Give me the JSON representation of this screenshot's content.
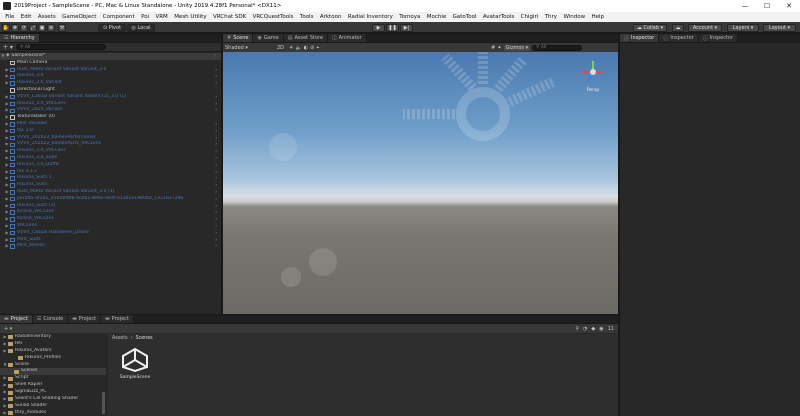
{
  "window": {
    "title": "2019Project - SampleScene - PC, Mac & Linux Standalone - Unity 2019.4.28f1 Personal* <DX11>",
    "minimize": "—",
    "maximize": "☐",
    "close": "✕"
  },
  "menu": [
    "File",
    "Edit",
    "Assets",
    "GameObject",
    "Component",
    "Poi",
    "VRM",
    "Mesh Utility",
    "VRChat SDK",
    "VRCQuestTools",
    "Tools",
    "Arktoon",
    "Radial Inventory",
    "Tomoya",
    "Mochie",
    "GatoTool",
    "AvatarTools",
    "Chigiri",
    "Thry",
    "Window",
    "Help"
  ],
  "toolbar": {
    "pivot": "Pivot",
    "local": "Local",
    "play": "▶",
    "pause": "❚❚",
    "step": "▶|",
    "collab": "Collab ▾",
    "account": "Account ▾",
    "layers": "Layers ▾",
    "layout": "Layout ▾"
  },
  "hierarchy": {
    "tab": "Hierarchy",
    "add": "+ ▾",
    "search_placeholder": "All",
    "scene": "SampleScene*",
    "items": [
      {
        "label": "Main Camera",
        "prefab": false,
        "arrow": ""
      },
      {
        "label": "Rusk_MaRU Variant Variant Variant_3.0",
        "prefab": true,
        "arrow": "▶"
      },
      {
        "label": "Rikuros_3.0",
        "prefab": true,
        "arrow": "▶"
      },
      {
        "label": "Rikuros_3.0_Variant",
        "prefab": true,
        "arrow": "▶"
      },
      {
        "label": "Directional Light",
        "prefab": false,
        "arrow": ""
      },
      {
        "label": "VVVV_Casual Variant Variant Variant (1)_3.0 (1)",
        "prefab": true,
        "arrow": "▶"
      },
      {
        "label": "Rikuros_3.0_VRCLens",
        "prefab": true,
        "arrow": "▶"
      },
      {
        "label": "VVVV_2020_Variant",
        "prefab": true,
        "arrow": "▶"
      },
      {
        "label": "TextureBaker (0)",
        "prefab": false,
        "arrow": "▶"
      },
      {
        "label": "Moe Tatuebel",
        "prefab": true,
        "arrow": "▶"
      },
      {
        "label": "fox 3.0",
        "prefab": true,
        "arrow": "▶"
      },
      {
        "label": "VVVV_202022_KaihenParts(Clone)",
        "prefab": true,
        "arrow": "▶"
      },
      {
        "label": "VVVV_202022_KaihenParts_VRCLens",
        "prefab": true,
        "arrow": "▶"
      },
      {
        "label": "Rikuros_3.0_VRCLens",
        "prefab": true,
        "arrow": "▶"
      },
      {
        "label": "Rikuros_3.0_Suits",
        "prefab": true,
        "arrow": "▶"
      },
      {
        "label": "Rikuros_3.0_Outfit",
        "prefab": true,
        "arrow": "▶"
      },
      {
        "label": "fox 3.1.1",
        "prefab": true,
        "arrow": "▶"
      },
      {
        "label": "Rikuros_Suits 1",
        "prefab": true,
        "arrow": "▶"
      },
      {
        "label": "Rikuros_Suits",
        "prefab": true,
        "arrow": "▶"
      },
      {
        "label": "Rusk_MaRU Variant Variant Variant_3.0 (1)",
        "prefab": true,
        "arrow": "▶"
      },
      {
        "label": "peralta-dr2a1_d165bf8fb-6c0b1-8dde-0b4f-a13d1e1980b0_1321627246",
        "prefab": true,
        "arrow": "▶"
      },
      {
        "label": "Rikuros_Suits (1)",
        "prefab": true,
        "arrow": "▶"
      },
      {
        "label": "Kirana_VRCLens",
        "prefab": true,
        "arrow": "▶"
      },
      {
        "label": "Kirana_VRCLens",
        "prefab": true,
        "arrow": "▶"
      },
      {
        "label": "VRCLens",
        "prefab": true,
        "arrow": "▶"
      },
      {
        "label": "VVVV_Casual Halloween_Drone",
        "prefab": true,
        "arrow": "▶"
      },
      {
        "label": "Mint_Suits",
        "prefab": true,
        "arrow": "▶"
      },
      {
        "label": "Mint_Kemon",
        "prefab": true,
        "arrow": "▶"
      }
    ]
  },
  "scene": {
    "tabs": [
      "Scene",
      "Game",
      "Asset Store",
      "Animator"
    ],
    "shading": "Shaded ▾",
    "mode2d": "2D",
    "gizmos": "Gizmos ▾",
    "search_placeholder": "All",
    "persp": "Persp"
  },
  "inspector": {
    "tabs": [
      "Inspector",
      "Inspector",
      "Inspector"
    ]
  },
  "project": {
    "tabs": [
      "Project",
      "Console",
      "Project",
      "Project"
    ],
    "add": "+ ▾",
    "breadcrumb": [
      "Assets",
      "Scenes"
    ],
    "count": "11",
    "tree": [
      {
        "label": "RadialInventory",
        "arrow": "▶",
        "sel": false
      },
      {
        "label": "Rei",
        "arrow": "▶",
        "sel": false
      },
      {
        "label": "Rikuros_Avatars",
        "arrow": "▶",
        "sel": false
      },
      {
        "label": "Rikuros_Profiles",
        "arrow": "",
        "sel": false
      },
      {
        "label": "Scene",
        "arrow": "▼",
        "sel": false
      },
      {
        "label": "Scenes",
        "arrow": "",
        "sel": true
      },
      {
        "label": "Script",
        "arrow": "▶",
        "sel": false
      },
      {
        "label": "Shell Rapier",
        "arrow": "▶",
        "sel": false
      },
      {
        "label": "SigmaLizz_PC",
        "arrow": "▶",
        "sel": false
      },
      {
        "label": "Silent's Cel Shading Shader",
        "arrow": "▶",
        "sel": false
      },
      {
        "label": "Sunao Shader",
        "arrow": "▶",
        "sel": false
      },
      {
        "label": "thry_modules",
        "arrow": "▶",
        "sel": false
      }
    ],
    "asset_name": "SampleScene"
  }
}
